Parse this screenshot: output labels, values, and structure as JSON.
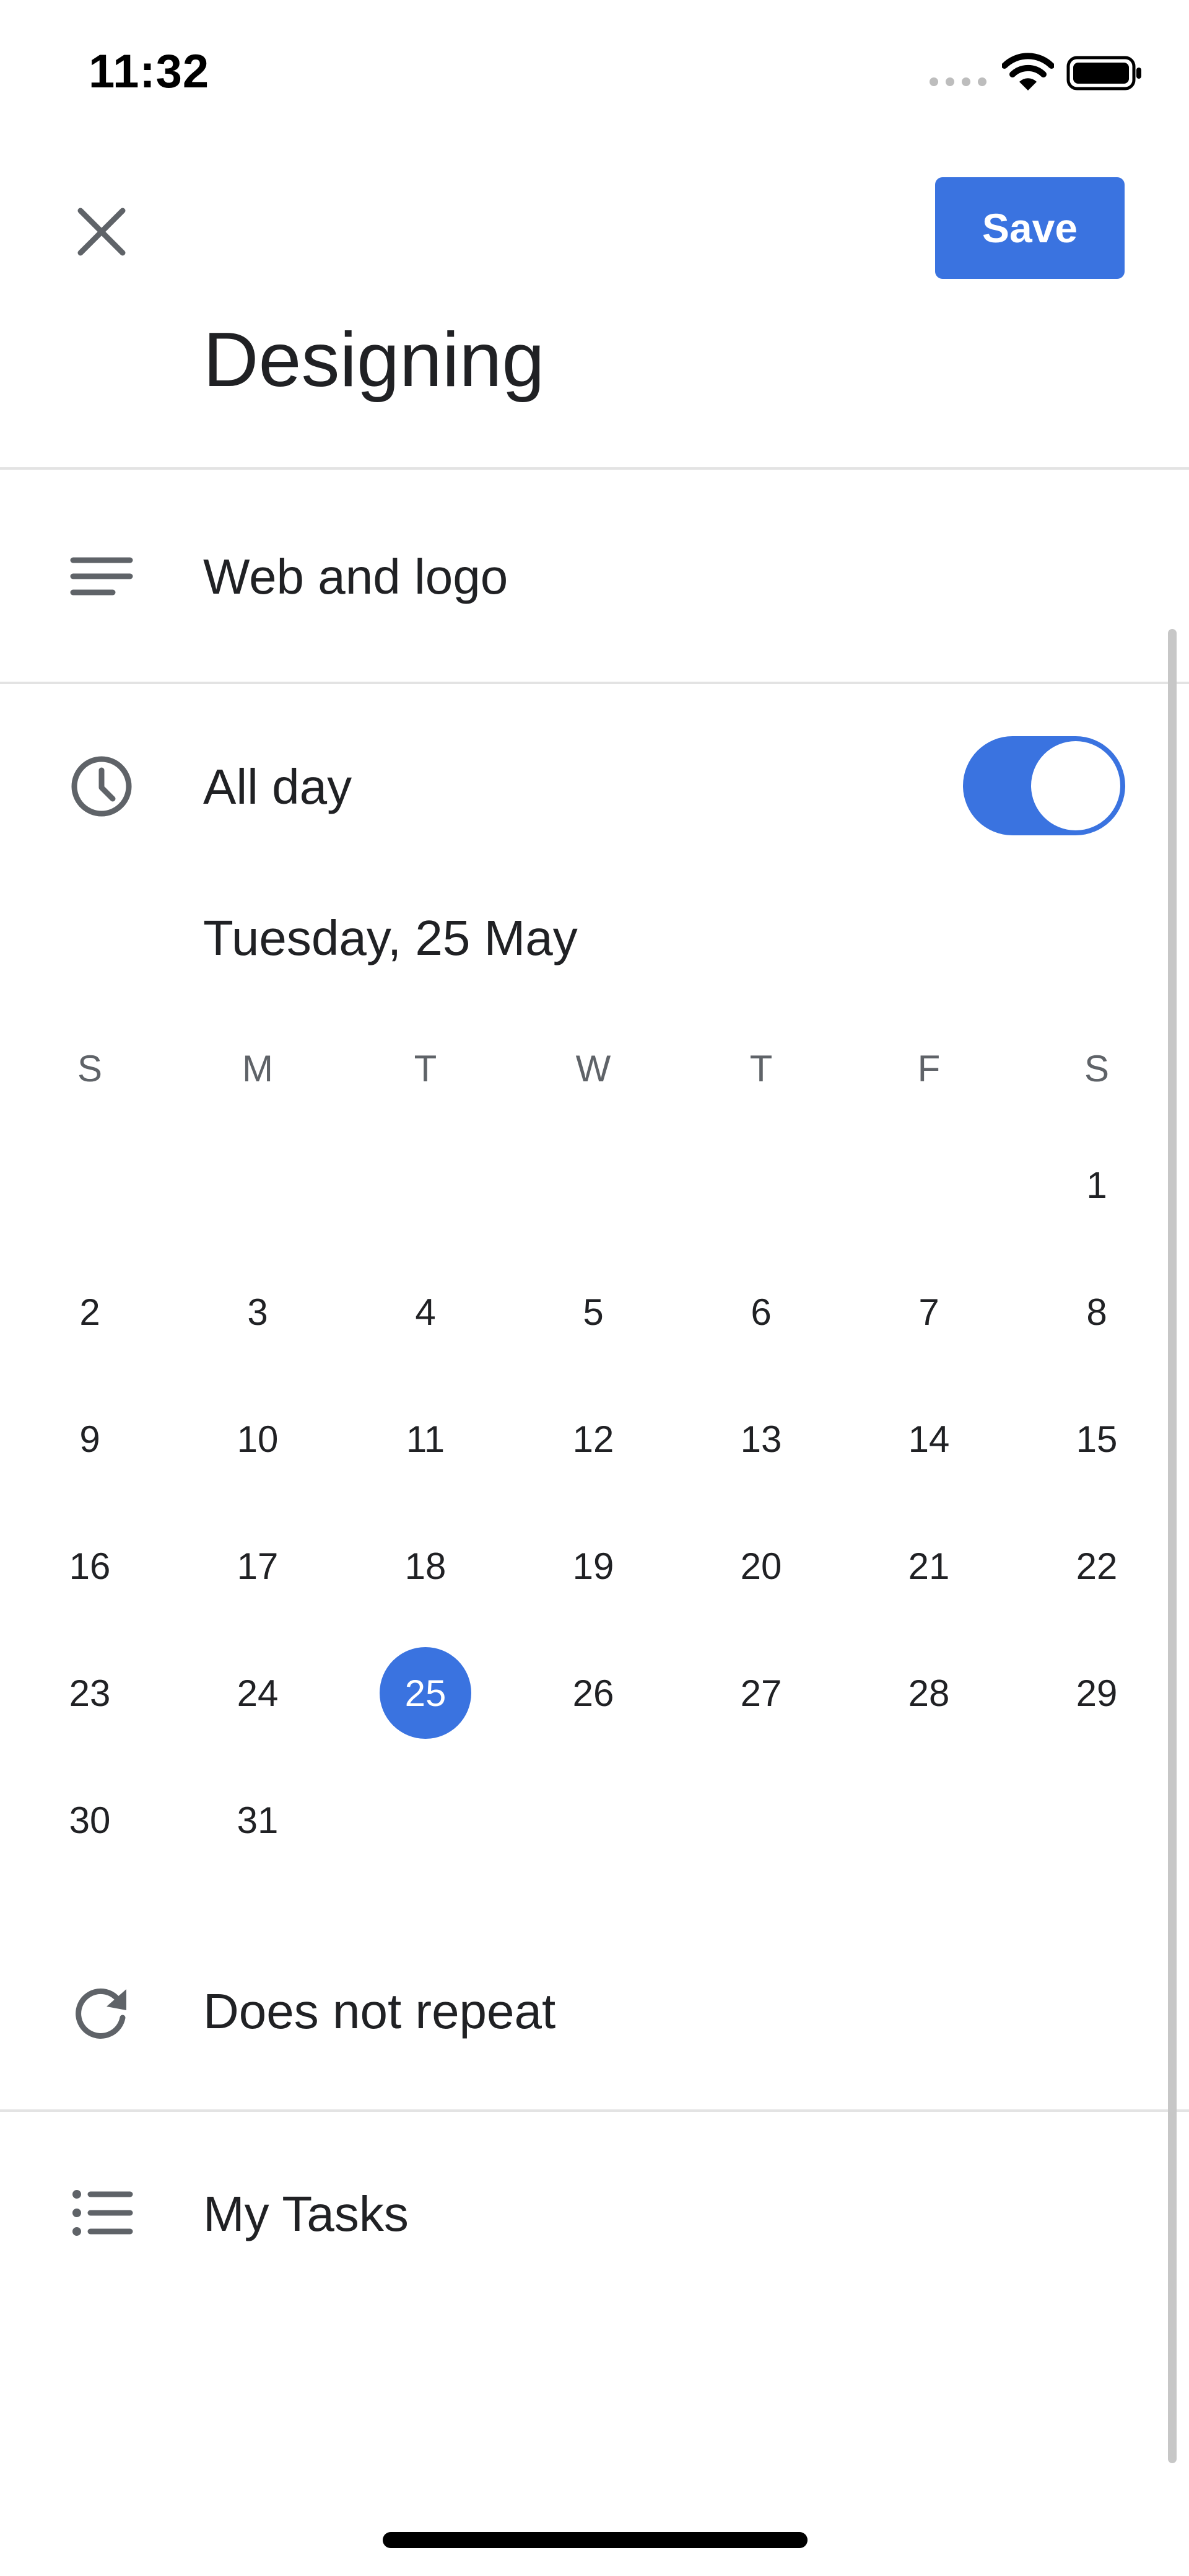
{
  "status_bar": {
    "time": "11:32",
    "icons": [
      "signal-dots-icon",
      "wifi-icon",
      "battery-icon"
    ]
  },
  "header": {
    "close_icon": "close-icon",
    "save_label": "Save",
    "title": "Designing"
  },
  "description": {
    "icon": "notes-icon",
    "text": "Web and logo"
  },
  "all_day": {
    "icon": "clock-icon",
    "label": "All day",
    "toggle_on": true
  },
  "date": {
    "label": "Tuesday, 25 May"
  },
  "calendar": {
    "weekdays": [
      "S",
      "M",
      "T",
      "W",
      "T",
      "F",
      "S"
    ],
    "first_weekday_index": 6,
    "days_in_month": 31,
    "selected_day": "25",
    "days": [
      "1",
      "2",
      "3",
      "4",
      "5",
      "6",
      "7",
      "8",
      "9",
      "10",
      "11",
      "12",
      "13",
      "14",
      "15",
      "16",
      "17",
      "18",
      "19",
      "20",
      "21",
      "22",
      "23",
      "24",
      "25",
      "26",
      "27",
      "28",
      "29",
      "30",
      "31"
    ]
  },
  "repeat": {
    "icon": "repeat-icon",
    "text": "Does not repeat"
  },
  "task_list": {
    "icon": "list-icon",
    "text": "My Tasks"
  },
  "colors": {
    "accent": "#3a73e0",
    "text": "#202124",
    "icon": "#5f6368",
    "divider": "#e3e3e3"
  }
}
